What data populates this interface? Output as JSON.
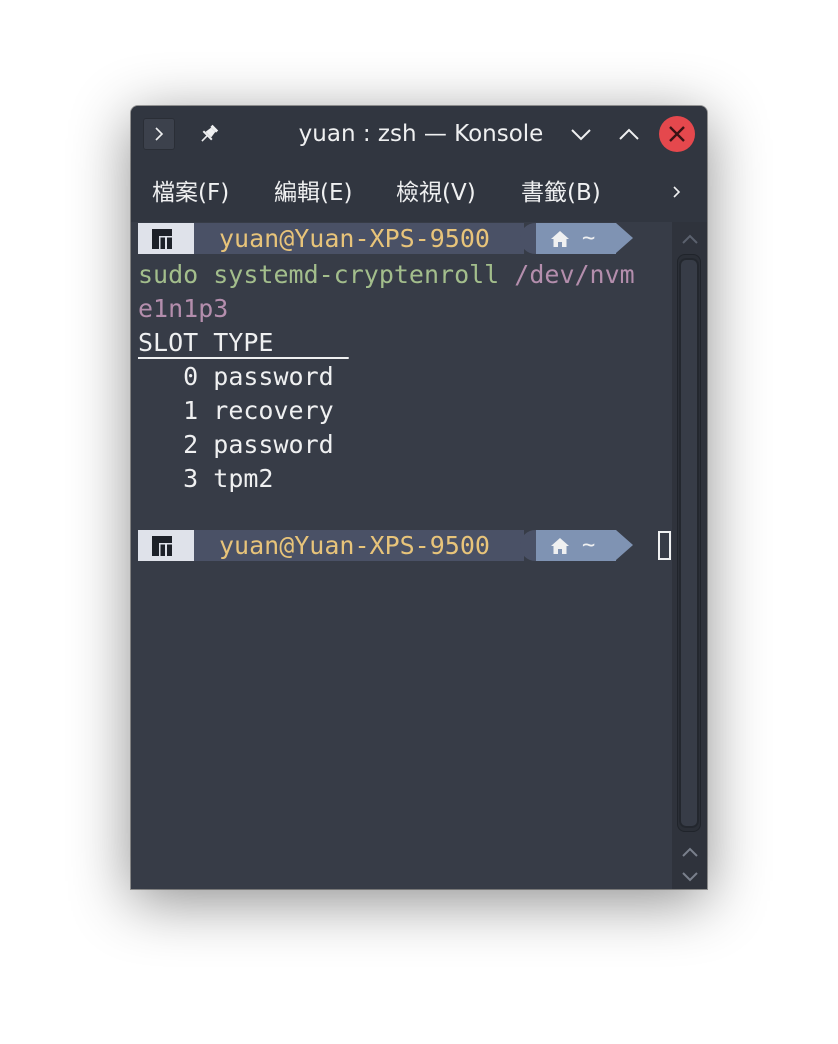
{
  "window": {
    "title": "yuan : zsh — Konsole"
  },
  "menu": {
    "items": [
      "檔案(F)",
      "編輯(E)",
      "檢視(V)",
      "書籤(B)"
    ],
    "more_icon": "chevron-right-icon"
  },
  "prompt": {
    "user_host": "yuan@Yuan-XPS-9500",
    "home_icon": "home-icon",
    "dir": "~"
  },
  "terminal": {
    "command_name": "sudo systemd-cryptenroll",
    "command_arg_part1": "/dev/nvm",
    "command_arg_part2": "e1n1p3",
    "table_header": "SLOT TYPE     ",
    "rows": [
      {
        "slot": "0",
        "type": "password"
      },
      {
        "slot": "1",
        "type": "recovery"
      },
      {
        "slot": "2",
        "type": "password"
      },
      {
        "slot": "3",
        "type": "tpm2"
      }
    ]
  },
  "colors": {
    "background": "#373c47",
    "titlebar": "#313640",
    "command": "#a3be8c",
    "path": "#b48ead",
    "user_host": "#e8c47a",
    "close_button": "#e5484d"
  }
}
